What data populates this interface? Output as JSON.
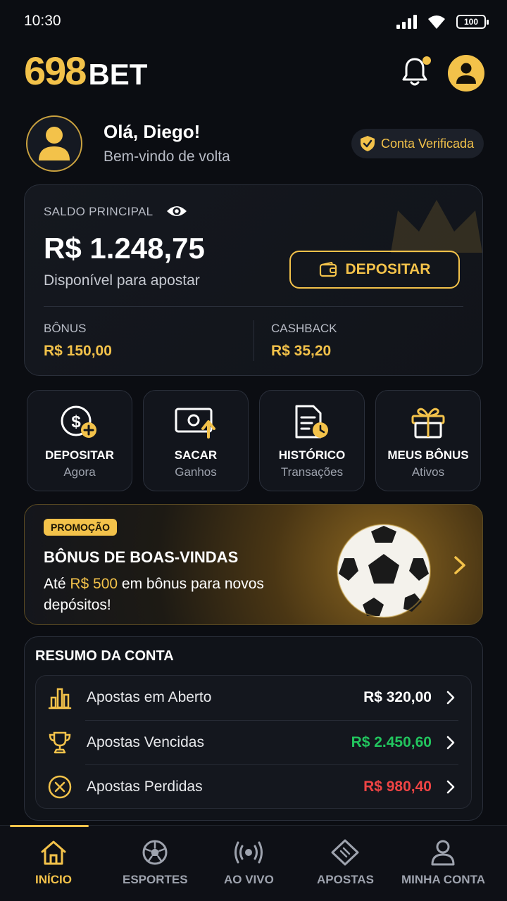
{
  "status_bar": {
    "time": "10:30",
    "battery": "100"
  },
  "header": {
    "logo_number": "698",
    "logo_text": "BET"
  },
  "greeting": {
    "title": "Olá, Diego!",
    "subtitle": "Bem-vindo de volta",
    "verified_label": "Conta Verificada"
  },
  "balance": {
    "label": "SALDO PRINCIPAL",
    "value": "R$ 1.248,75",
    "sub": "Disponível para apostar",
    "deposit_label": "DEPOSITAR",
    "bonus_label": "BÔNUS",
    "bonus_value": "R$ 150,00",
    "cashback_label": "CASHBACK",
    "cashback_value": "R$ 35,20"
  },
  "quick_actions": [
    {
      "title": "DEPOSITAR",
      "sub": "Agora",
      "icon": "dollar-plus-icon"
    },
    {
      "title": "SACAR",
      "sub": "Ganhos",
      "icon": "cash-withdraw-icon"
    },
    {
      "title": "HISTÓRICO",
      "sub": "Transações",
      "icon": "document-history-icon"
    },
    {
      "title": "MEUS BÔNUS",
      "sub": "Ativos",
      "icon": "gift-icon"
    }
  ],
  "promo": {
    "badge": "PROMOÇÃO",
    "title": "BÔNUS DE BOAS-VINDAS",
    "text_before": "Até ",
    "text_highlight": "R$ 500",
    "text_after": " em bônus para novos depósitos!"
  },
  "summary": {
    "title": "RESUMO DA CONTA",
    "rows": [
      {
        "label": "Apostas em Aberto",
        "value": "R$ 320,00",
        "color": "#ffffff",
        "icon": "bar-chart-icon"
      },
      {
        "label": "Apostas Vencidas",
        "value": "R$ 2.450,60",
        "color": "#22c55e",
        "icon": "trophy-icon"
      },
      {
        "label": "Apostas Perdidas",
        "value": "R$ 980,40",
        "color": "#ef4444",
        "icon": "x-circle-icon"
      }
    ]
  },
  "bottom_nav": [
    {
      "label": "INÍCIO",
      "icon": "home-icon",
      "active": true
    },
    {
      "label": "ESPORTES",
      "icon": "soccer-ball-icon",
      "active": false
    },
    {
      "label": "AO VIVO",
      "icon": "live-broadcast-icon",
      "active": false
    },
    {
      "label": "APOSTAS",
      "icon": "ticket-icon",
      "active": false
    },
    {
      "label": "MINHA CONTA",
      "icon": "user-icon",
      "active": false
    }
  ],
  "colors": {
    "accent": "#f3c24a",
    "background": "#0b0d12",
    "win": "#22c55e",
    "loss": "#ef4444"
  }
}
